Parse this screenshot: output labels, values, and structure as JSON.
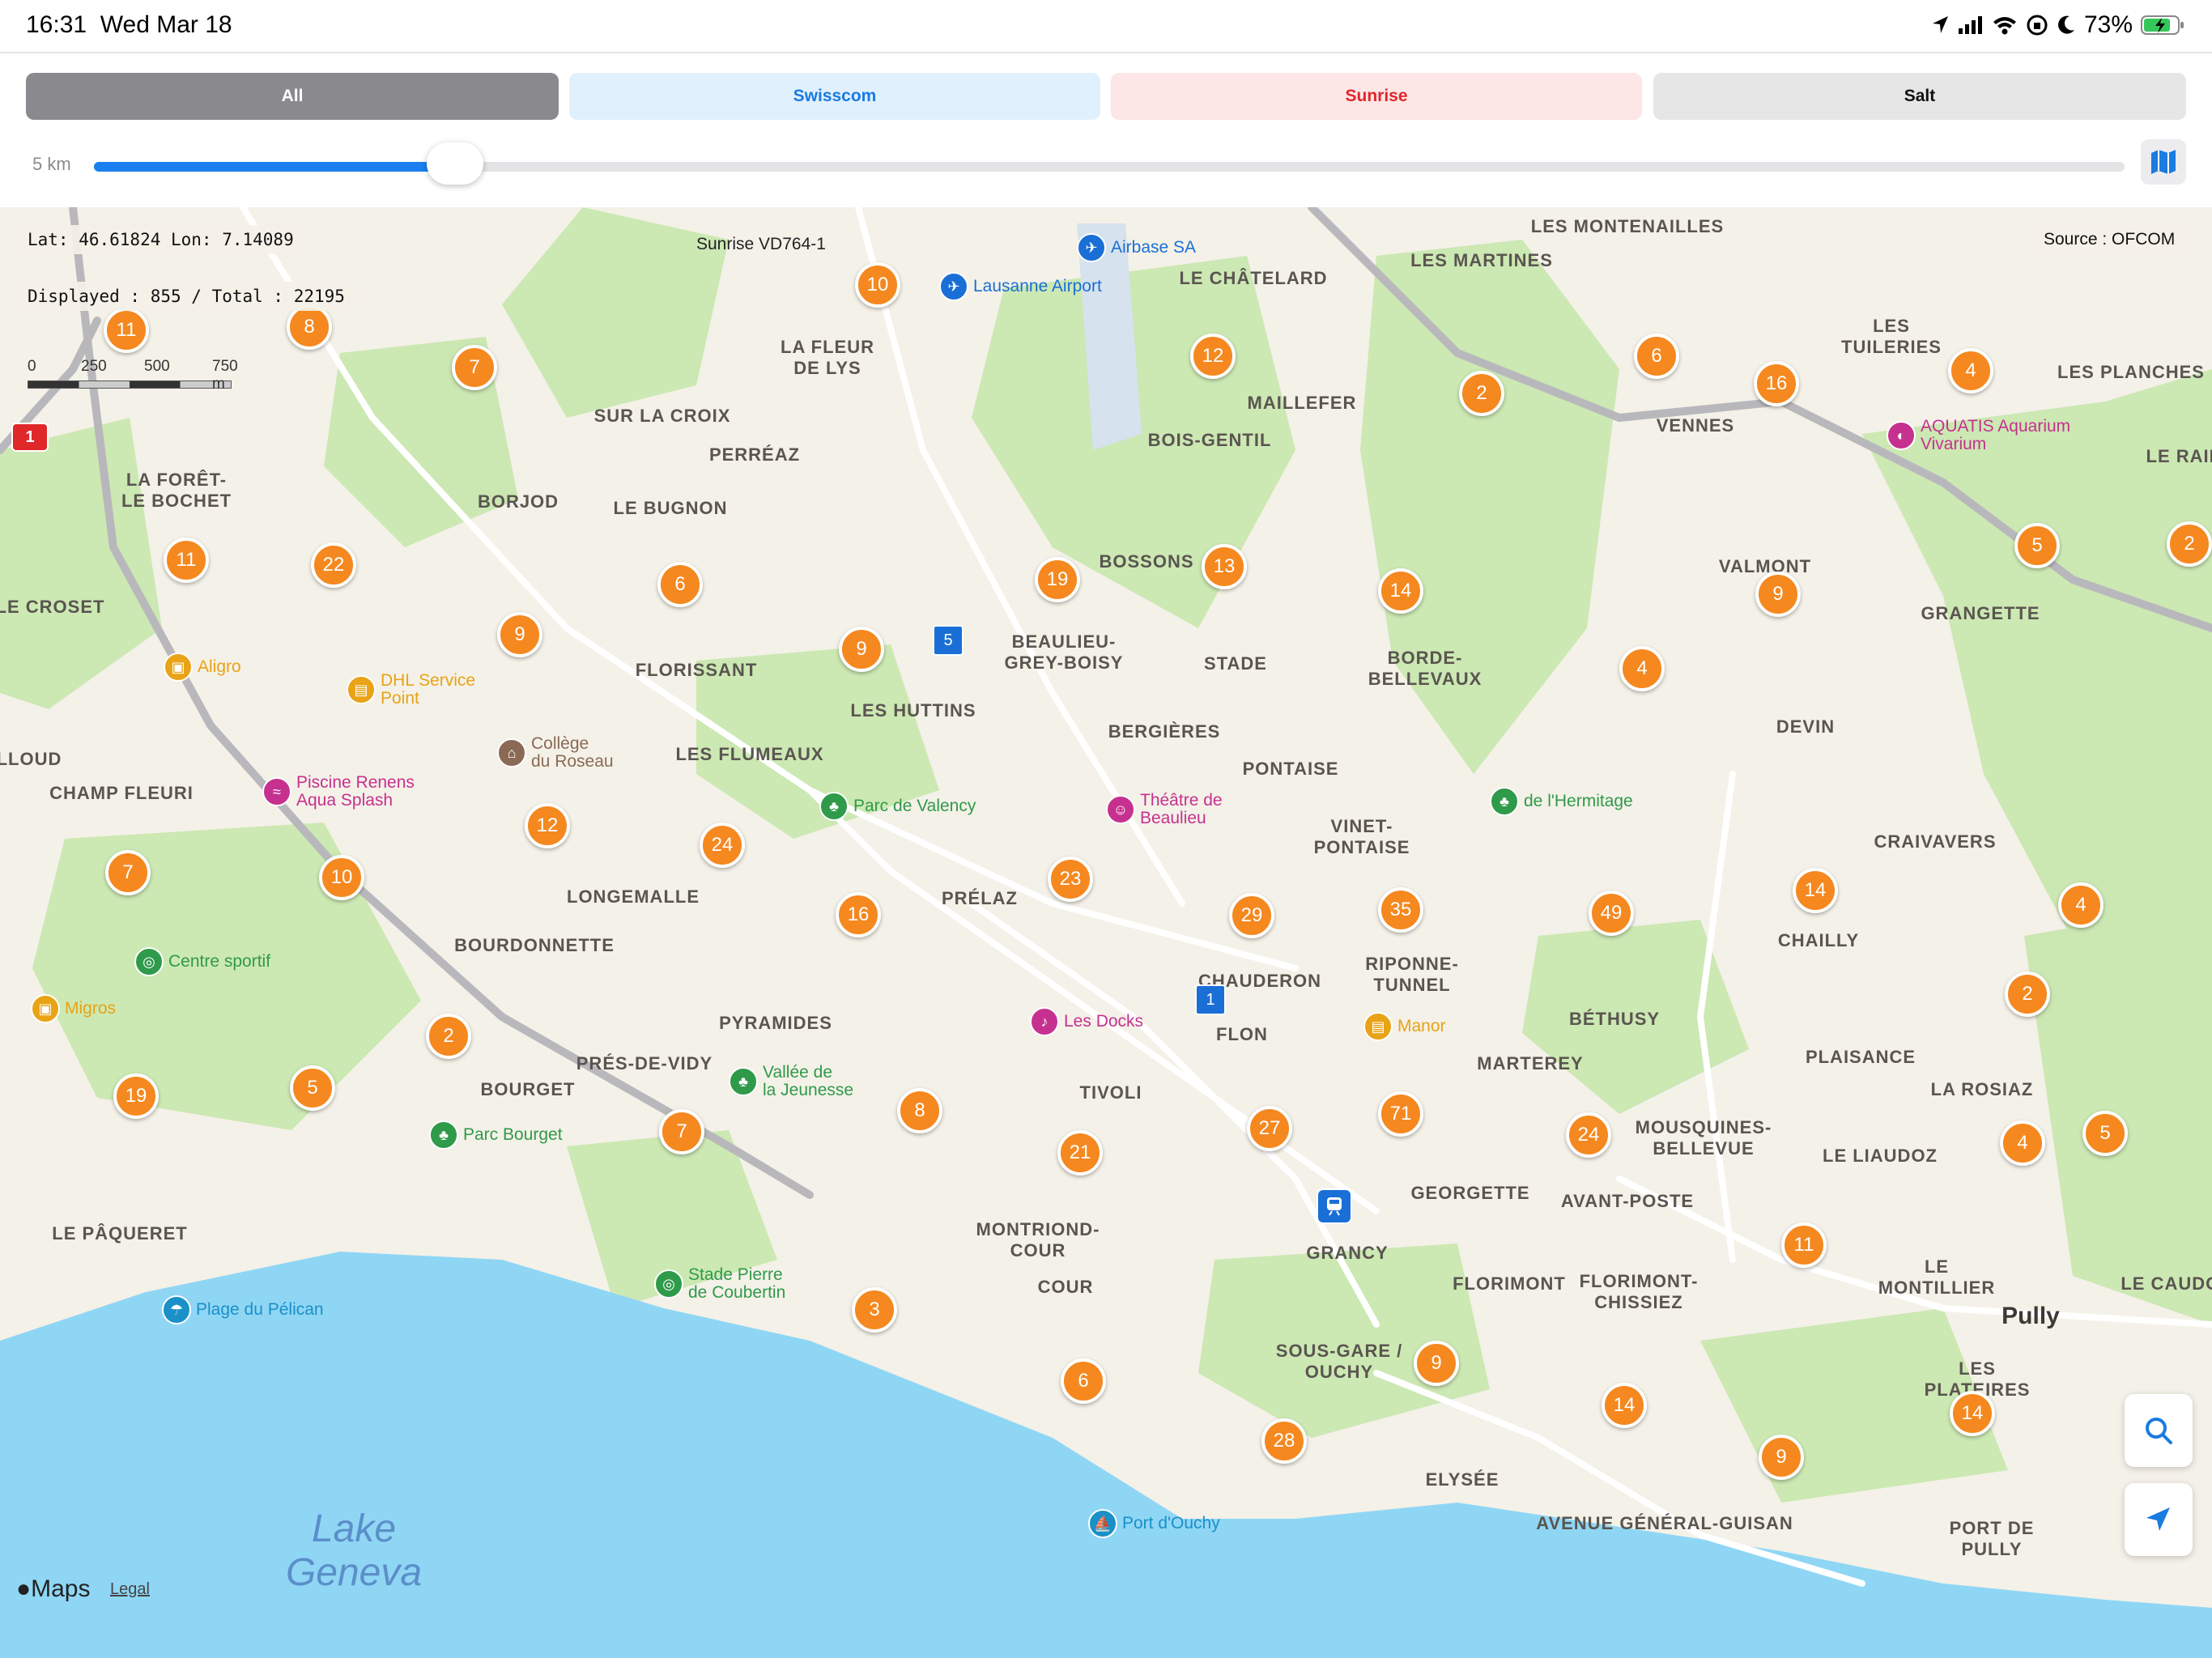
{
  "status_bar": {
    "time": "16:31",
    "date": "Wed Mar 18",
    "battery": "73%"
  },
  "filters": {
    "all": "All",
    "swisscom": "Swisscom",
    "sunrise": "Sunrise",
    "salt": "Salt",
    "selected": "All",
    "colors": {
      "all": "#8a8a8e",
      "swisscom": "#1a7be0",
      "sunrise": "#e0272a",
      "salt": "#111111"
    }
  },
  "radius": {
    "label": "5 km",
    "fraction": 0.09
  },
  "map": {
    "coords": "Lat: 46.61824  Lon: 7.14089",
    "displayed": "Displayed : 855 / Total : 22195",
    "source": "Source : OFCOM",
    "scale": {
      "ticks": [
        "0",
        "250",
        "500",
        "750 m"
      ]
    },
    "highlighted_antenna": "Sunrise VD764-1",
    "attribution": "Maps",
    "legal": "Legal",
    "cluster_color": "#f5881f",
    "lake_color": "#8fd6f5",
    "places": [
      "LES MONTENAILLES",
      "LES MARTINES",
      "LE CHÂTELARD",
      "LES\nTUILERIES",
      "LES PLANCHES",
      "LE RAIDILL",
      "LA FLEUR\nDE LYS",
      "SUR LA CROIX",
      "PERRÉAZ",
      "MAILLEFER",
      "BOIS-GENTIL",
      "VENNES",
      "LA FORÊT-\nLE BOCHET",
      "BORJOD",
      "LE BUGNON",
      "BOSSONS",
      "LE CROSET",
      "VALMONT",
      "GRANGETTE",
      "BEAULIEU-\nGREY-BOISY",
      "STADE",
      "BORDE-\nBELLEVAUX",
      "FLORISSANT",
      "LES HUTTINS",
      "BERGIÈRES",
      "DEVIN",
      "LLOUD",
      "LES FLUMEAUX",
      "PONTAISE",
      "CHAMP FLEURI",
      "VINET-\nPONTAISE",
      "CRAIVAVERS",
      "LONGEMALLE",
      "PRÉLAZ",
      "CHAILLY",
      "BOURDONNETTE",
      "CHAUDERON",
      "RIPONNE-\nTUNNEL",
      "PYRAMIDES",
      "FLON",
      "BÉTHUSY",
      "MARTEREY",
      "PLAISANCE",
      "PRÉS-DE-VIDY",
      "BOURGET",
      "TIVOLI",
      "LA ROSIAZ",
      "MOUSQUINES-\nBELLEVUE",
      "LE LIAUDOZ",
      "GEORGETTE",
      "AVANT-POSTE",
      "LE PÂQUERET",
      "MONTRIOND-\nCOUR",
      "GRANCY",
      "LE\nMONTILLIER",
      "LE CAUDOZ",
      "COUR",
      "FLORIMONT",
      "FLORIMONT-\nCHISSIEZ",
      "SOUS-GARE /\nOUCHY",
      "LES\nPLATEIRES",
      "ELYSÉE",
      "PORT DE\nPULLY",
      "AVENUE GÉNÉRAL-GUISAN"
    ],
    "town": "Pully",
    "lake": "Lake\nGeneva",
    "pois": [
      {
        "label": "Airbase SA",
        "color": "#1a6fd6",
        "icon": "plane-icon"
      },
      {
        "label": "Lausanne Airport",
        "color": "#1a6fd6",
        "icon": "plane-icon"
      },
      {
        "label": "AQUATIS Aquarium\nVivarium",
        "color": "#c6318f",
        "icon": "fish-icon"
      },
      {
        "label": "Aligro",
        "color": "#e8a316",
        "icon": "cart-icon"
      },
      {
        "label": "DHL Service\nPoint",
        "color": "#e8a316",
        "icon": "bag-icon"
      },
      {
        "label": "Collège\ndu Roseau",
        "color": "#8a6a55",
        "icon": "school-icon"
      },
      {
        "label": "Piscine Renens\nAqua Splash",
        "color": "#c6318f",
        "icon": "pool-icon"
      },
      {
        "label": "Parc de Valency",
        "color": "#2f9a4a",
        "icon": "tree-icon"
      },
      {
        "label": "Théâtre de\nBeaulieu",
        "color": "#c6318f",
        "icon": "theatre-icon"
      },
      {
        "label": "de l'Hermitage",
        "color": "#2f9a4a",
        "icon": "tree-icon"
      },
      {
        "label": "Centre sportif",
        "color": "#2f9a4a",
        "icon": "sport-icon"
      },
      {
        "label": "Migros",
        "color": "#e8a316",
        "icon": "cart-icon"
      },
      {
        "label": "Les Docks",
        "color": "#c6318f",
        "icon": "music-icon"
      },
      {
        "label": "Manor",
        "color": "#e8a316",
        "icon": "bag-icon"
      },
      {
        "label": "Vallée de\nla Jeunesse",
        "color": "#2f9a4a",
        "icon": "tree-icon"
      },
      {
        "label": "Parc Bourget",
        "color": "#2f9a4a",
        "icon": "tree-icon"
      },
      {
        "label": "Stade Pierre\nde Coubertin",
        "color": "#2f9a4a",
        "icon": "sport-icon"
      },
      {
        "label": "Plage du Pélican",
        "color": "#1a90c8",
        "icon": "beach-icon"
      },
      {
        "label": "Port d'Ouchy",
        "color": "#1a90c8",
        "icon": "boat-icon"
      }
    ],
    "clusters": [
      "11",
      "8",
      "7",
      "10",
      "12",
      "6",
      "2",
      "16",
      "4",
      "11",
      "22",
      "6",
      "9",
      "19",
      "13",
      "14",
      "5",
      "2",
      "9",
      "9",
      "4",
      "12",
      "24",
      "10",
      "7",
      "16",
      "23",
      "29",
      "35",
      "49",
      "14",
      "4",
      "2",
      "19",
      "5",
      "2",
      "7",
      "8",
      "21",
      "27",
      "71",
      "24",
      "4",
      "5",
      "11",
      "3",
      "6",
      "9",
      "28",
      "14",
      "9",
      "14"
    ]
  }
}
